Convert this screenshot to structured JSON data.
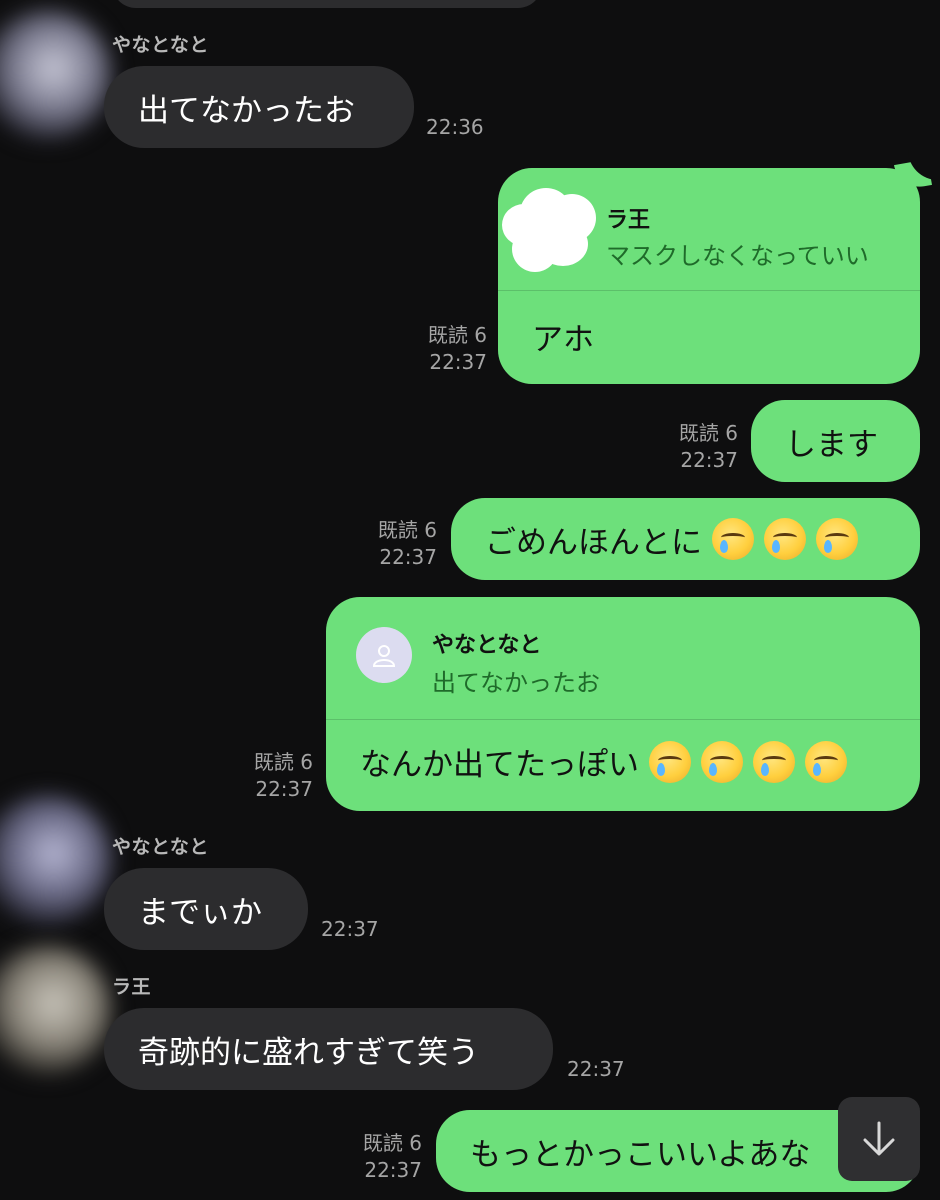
{
  "messages": {
    "m1": {
      "sender": "やなとなと",
      "text": "出てなかったお",
      "time": "22:36"
    },
    "m2": {
      "quote_name": "ラ王",
      "quote_text": "マスクしなくなっていい",
      "text": "アホ",
      "read": "既読 6",
      "time": "22:37"
    },
    "m3": {
      "text": "します",
      "read": "既読 6",
      "time": "22:37"
    },
    "m4": {
      "text": "ごめんほんとに",
      "read": "既読 6",
      "time": "22:37",
      "emoji": [
        "crying-face",
        "crying-face",
        "crying-face"
      ]
    },
    "m5": {
      "quote_name": "やなとなと",
      "quote_text": "出てなかったお",
      "text": "なんか出てたっぽい",
      "read": "既読 6",
      "time": "22:37",
      "emoji": [
        "crying-face",
        "crying-face",
        "crying-face",
        "crying-face"
      ]
    },
    "m6": {
      "sender": "やなとなと",
      "text": "までぃか",
      "time": "22:37"
    },
    "m7": {
      "sender": "ラ王",
      "text": "奇跡的に盛れすぎて笑う",
      "time": "22:37"
    },
    "m8": {
      "text": "もっとかっこいいよあな",
      "read": "既読 6",
      "time": "22:37"
    }
  },
  "controls": {
    "scroll_down_icon": "arrow-down-icon"
  },
  "colors": {
    "background": "#0e0e0f",
    "incoming_bubble": "#2c2c2e",
    "outgoing_bubble": "#6de07b"
  }
}
